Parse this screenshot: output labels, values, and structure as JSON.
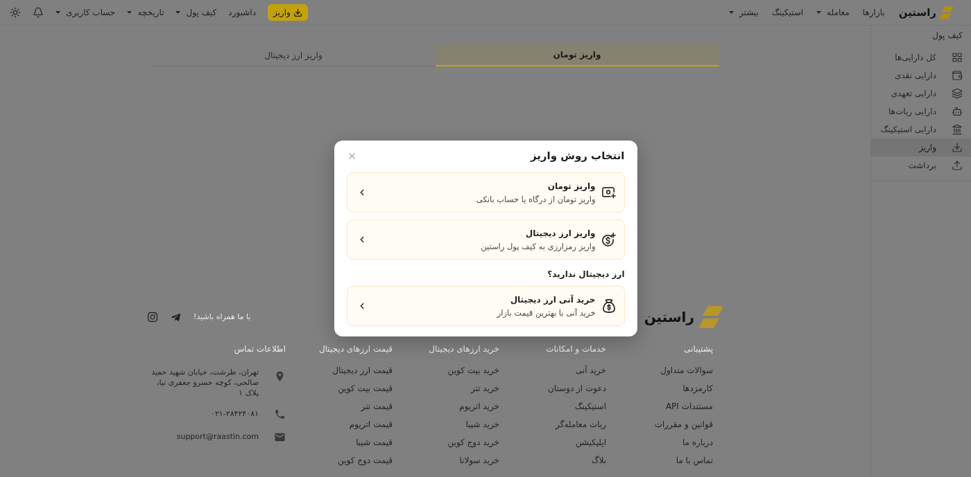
{
  "header": {
    "logo": "راستین",
    "nav": [
      {
        "label": "بازارها",
        "has_menu": false
      },
      {
        "label": "معامله",
        "has_menu": true
      },
      {
        "label": "استیکینگ",
        "has_menu": false
      },
      {
        "label": "بیشتر",
        "has_menu": true
      }
    ],
    "deposit_button": "واریز",
    "user_nav": [
      {
        "label": "داشبورد",
        "has_menu": false
      },
      {
        "label": "کیف پول",
        "has_menu": true
      },
      {
        "label": "تاریخچه",
        "has_menu": true
      },
      {
        "label": "حساب کاربری",
        "has_menu": true
      }
    ]
  },
  "sidebar": {
    "title": "کیف پول",
    "items": [
      {
        "label": "کل دارایی‌ها",
        "selected": false
      },
      {
        "label": "دارایی نقدی",
        "selected": false
      },
      {
        "label": "دارایی تعهدی",
        "selected": false
      },
      {
        "label": "دارایی ربات‌ها",
        "selected": false
      },
      {
        "label": "دارایی استیکینگ",
        "selected": false
      },
      {
        "label": "واریز",
        "selected": true
      },
      {
        "label": "برداشت",
        "selected": false
      }
    ]
  },
  "tabs": [
    {
      "label": "واریز تومان",
      "selected": true
    },
    {
      "label": "واریز ارز دیجیتال",
      "selected": false
    }
  ],
  "modal": {
    "title": "انتخاب روش واریز",
    "options": [
      {
        "title": "واریز تومان",
        "subtitle": "واریز تومان از درگاه یا حساب بانکی"
      },
      {
        "title": "واریز ارز دیجیتال",
        "subtitle": "واریز رمزارزی به کیف پول راستین"
      }
    ],
    "section_heading": "ارز دیجیتال ندارید؟",
    "extra_options": [
      {
        "title": "خرید آنی ارز دیجیتال",
        "subtitle": "خرید آنی با بهترین قیمت بازار"
      }
    ]
  },
  "footer": {
    "logo": "راستین",
    "social_prompt": "با ما همراه باشید!",
    "columns": [
      {
        "heading": "پشتیبانی",
        "links": [
          "سوالات متداول",
          "کارمزدها",
          "مستندات API",
          "قوانین و مقررات",
          "درباره ما",
          "تماس با ما"
        ]
      },
      {
        "heading": "خدمات و امکانات",
        "links": [
          "خرید آنی",
          "دعوت از دوستان",
          "استیکینگ",
          "ربات معامله‌گر",
          "اپلیکیشن",
          "بلاگ"
        ]
      },
      {
        "heading": "خرید ارزهای دیجیتال",
        "links": [
          "خرید بیت کوین",
          "خرید تتر",
          "خرید اتریوم",
          "خرید شیبا",
          "خرید دوج کوین",
          "خرید سولانا"
        ]
      },
      {
        "heading": "قیمت ارزهای دیجیتال",
        "links": [
          "قیمت ارز دیجیتال",
          "قیمت بیت کوین",
          "قیمت تتر",
          "قیمت اتریوم",
          "قیمت شیبا",
          "قیمت دوج کوین"
        ]
      }
    ],
    "contact": {
      "heading": "اطلاعات تماس",
      "address": "تهران، طرشت، خیابان شهید حمید صالحی، کوچه خسرو جعفری نیا، پلاک ۱",
      "phone": "۰۲۱-۲۸۴۲۴۰۸۱",
      "email": "support@raastin.com"
    }
  }
}
